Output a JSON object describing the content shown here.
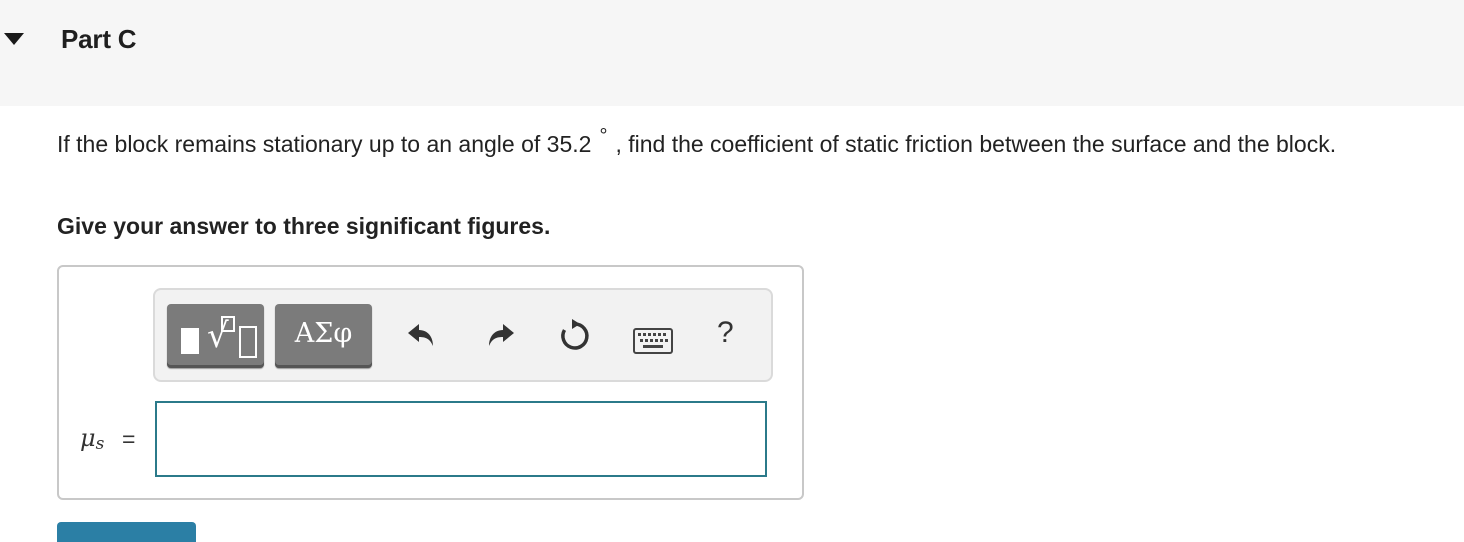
{
  "header": {
    "part_title": "Part C"
  },
  "question": {
    "text_before": "If the block remains stationary up to an angle of 35.2",
    "degree_symbol": "°",
    "text_after": ", find the coefficient of static friction between the surface and the block."
  },
  "instruction": "Give your answer to three significant figures.",
  "toolbar": {
    "symbols_label": "ΑΣφ",
    "help_label": "?",
    "icons": [
      "templates-icon",
      "undo-icon",
      "redo-icon",
      "reset-icon",
      "keyboard-icon",
      "help-icon"
    ]
  },
  "answer": {
    "variable_symbol": "μ",
    "variable_subscript": "s",
    "equals": "=",
    "value": ""
  },
  "colors": {
    "header_bg": "#f6f6f6",
    "toolbar_button": "#7b7b7b",
    "input_border": "#2b7a8a",
    "submit_button": "#2b7fa5"
  }
}
